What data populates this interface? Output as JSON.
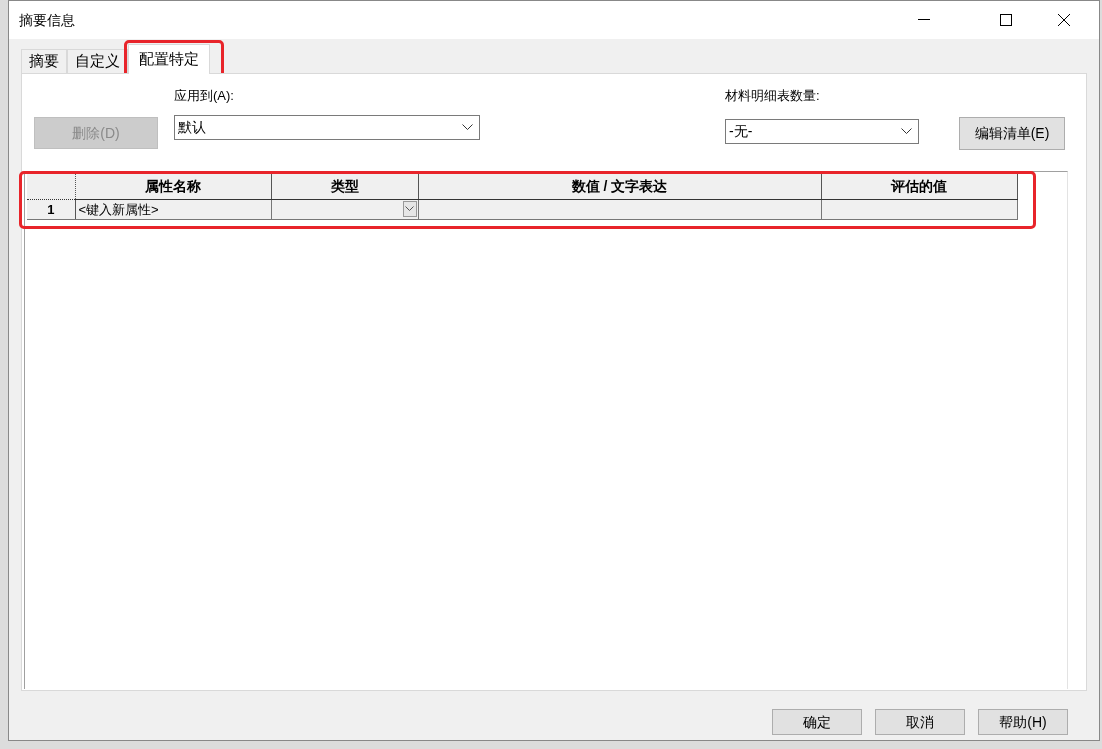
{
  "window": {
    "title": "摘要信息"
  },
  "tabs": [
    {
      "label": "摘要",
      "selected": false,
      "highlighted": false
    },
    {
      "label": "自定义",
      "selected": false,
      "highlighted": false
    },
    {
      "label": "配置特定",
      "selected": true,
      "highlighted": true
    }
  ],
  "delete_button": {
    "label": "删除(D)",
    "disabled": true
  },
  "apply_to": {
    "label": "应用到(A):",
    "value": "默认"
  },
  "bom_quantity": {
    "label": "材料明细表数量:",
    "value": "-无-"
  },
  "edit_list_button": {
    "label": "编辑清单(E)"
  },
  "table": {
    "highlighted": true,
    "columns": [
      "属性名称",
      "类型",
      "数值 / 文字表达",
      "评估的值"
    ],
    "rows": [
      {
        "number": "1",
        "cells": [
          "<键入新属性>",
          "",
          "",
          ""
        ]
      }
    ]
  },
  "buttons": [
    "确定",
    "取消",
    "帮助(H)"
  ]
}
